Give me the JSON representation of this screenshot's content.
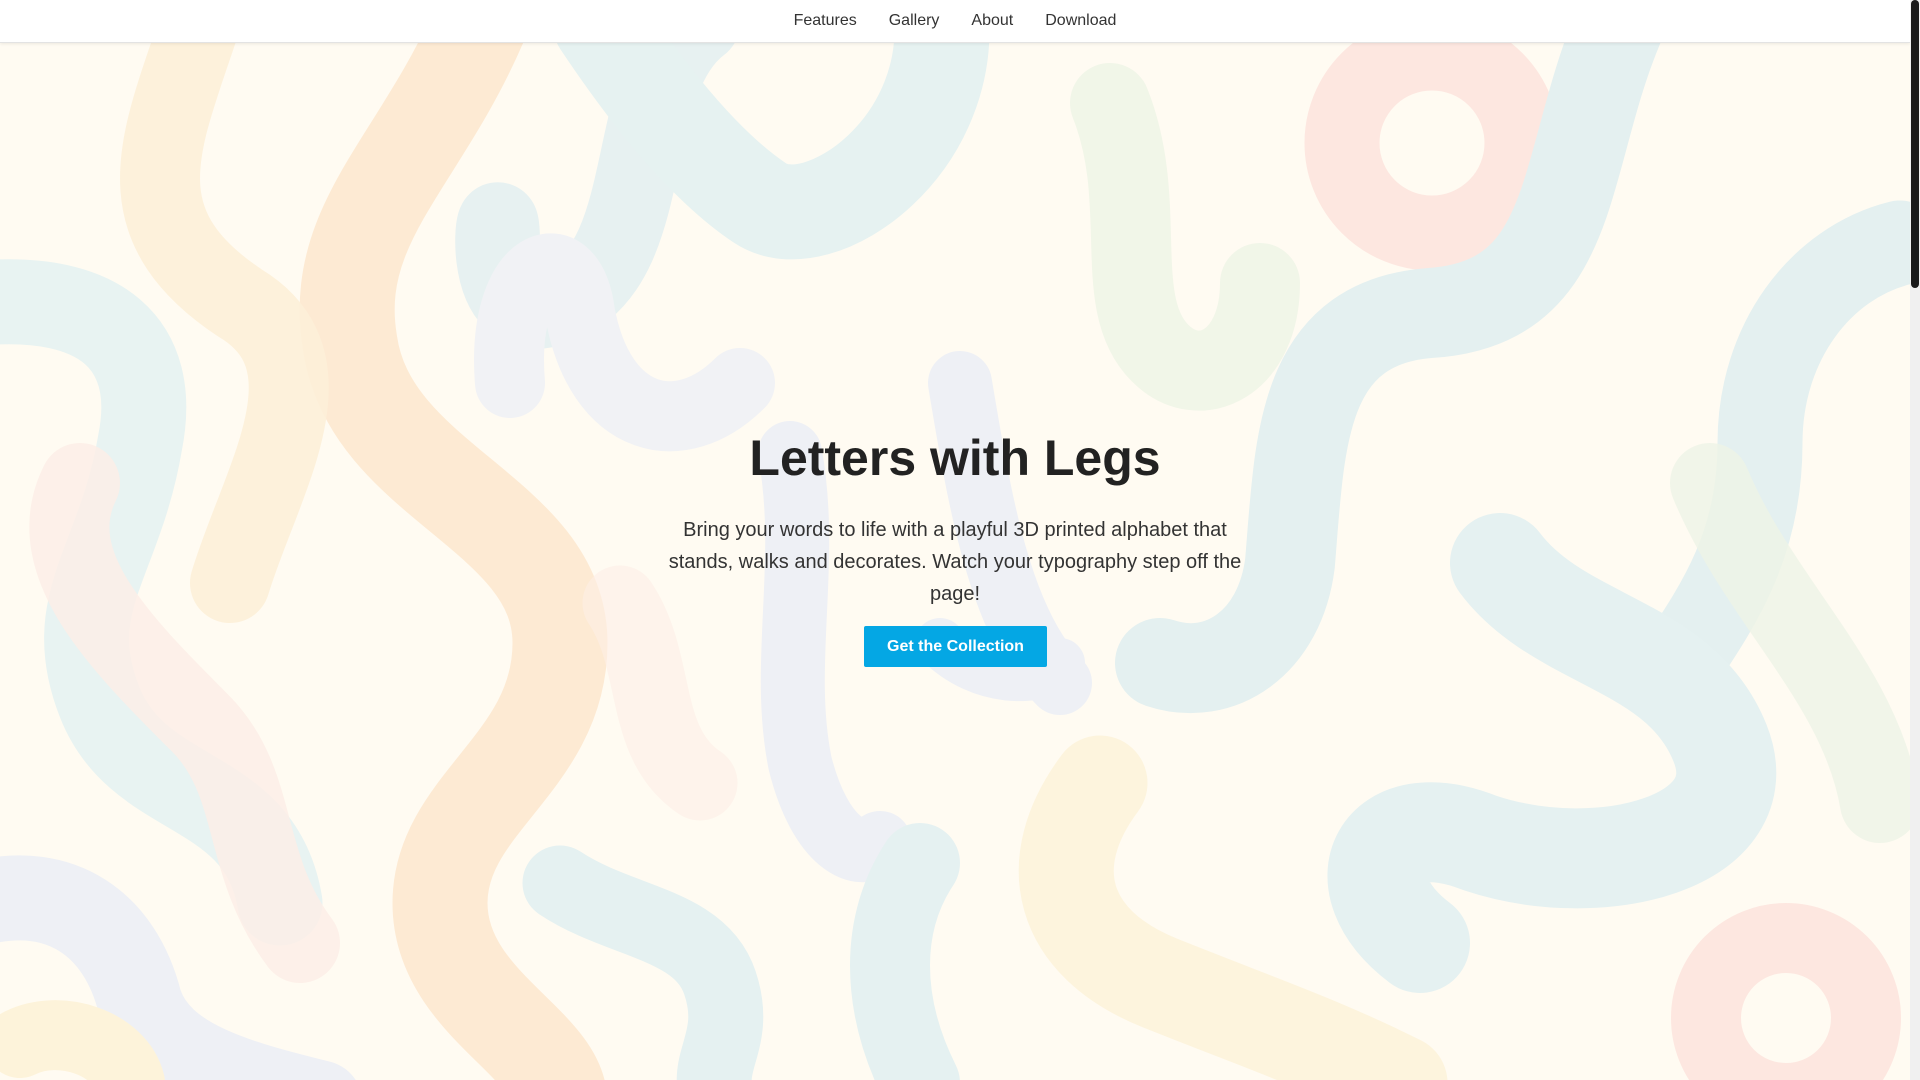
{
  "nav": {
    "items": [
      {
        "label": "Features"
      },
      {
        "label": "Gallery"
      },
      {
        "label": "About"
      },
      {
        "label": "Download"
      }
    ]
  },
  "hero": {
    "title": "Letters with Legs",
    "description": "Bring your words to life with a playful 3D printed alphabet that stands, walks and decorates. Watch your typography step off the page!",
    "cta_label": "Get the Collection"
  },
  "colors": {
    "accent": "#04a7e4",
    "background": "#fffbf2",
    "text": "#222222"
  }
}
